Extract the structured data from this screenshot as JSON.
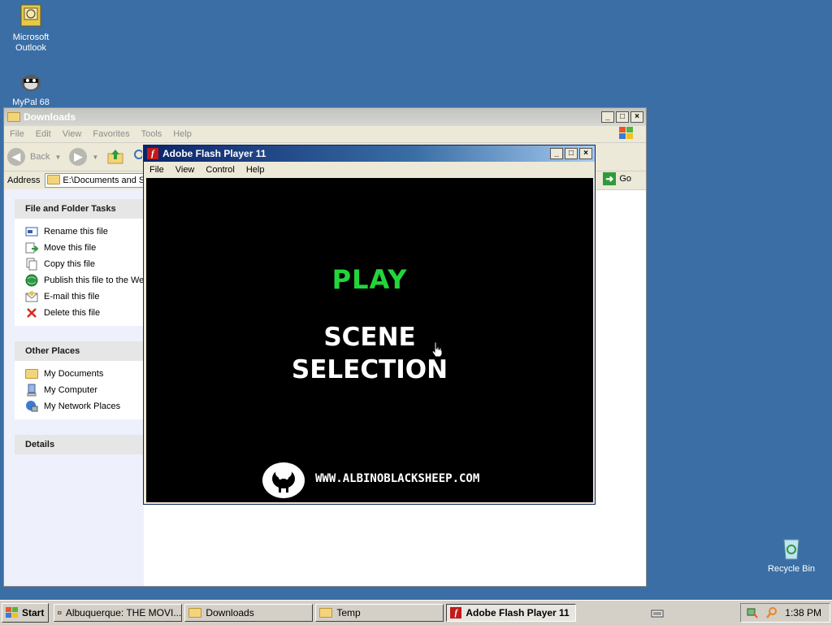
{
  "desktop": {
    "icons": [
      {
        "label": "Microsoft\nOutlook",
        "line1": "Microsoft",
        "line2": "Outlook"
      },
      {
        "label": "MyPal 68"
      },
      {
        "label": "Recycle Bin"
      }
    ]
  },
  "explorer": {
    "title": "Downloads",
    "menu": [
      "File",
      "Edit",
      "View",
      "Favorites",
      "Tools",
      "Help"
    ],
    "toolbar": {
      "back_label": "Back"
    },
    "address_label": "Address",
    "address_value": "E:\\Documents and Se",
    "go_label": "Go",
    "file_tasks": {
      "heading": "File and Folder Tasks",
      "items": [
        "Rename this file",
        "Move this file",
        "Copy this file",
        "Publish this file to the Wel",
        "E-mail this file",
        "Delete this file"
      ]
    },
    "other_places": {
      "heading": "Other Places",
      "items": [
        "My Documents",
        "My Computer",
        "My Network Places"
      ]
    },
    "details": {
      "heading": "Details"
    }
  },
  "flash": {
    "title": "Adobe Flash Player 11",
    "menu": [
      "File",
      "View",
      "Control",
      "Help"
    ],
    "play_label": "PLAY",
    "scene_line1": "SCENE",
    "scene_line2": "SELECTION",
    "site_url": "WWW.ALBINOBLACKSHEEP.COM"
  },
  "taskbar": {
    "start_label": "Start",
    "buttons": [
      {
        "label": "Albuquerque: THE MOVI..."
      },
      {
        "label": "Downloads"
      },
      {
        "label": "Temp"
      },
      {
        "label": "Adobe Flash Player 11",
        "active": true
      }
    ],
    "clock": "1:38 PM"
  },
  "colors": {
    "desktop": "#3a6ea5",
    "play_green": "#22d63a",
    "flash_stage": "#000000"
  }
}
